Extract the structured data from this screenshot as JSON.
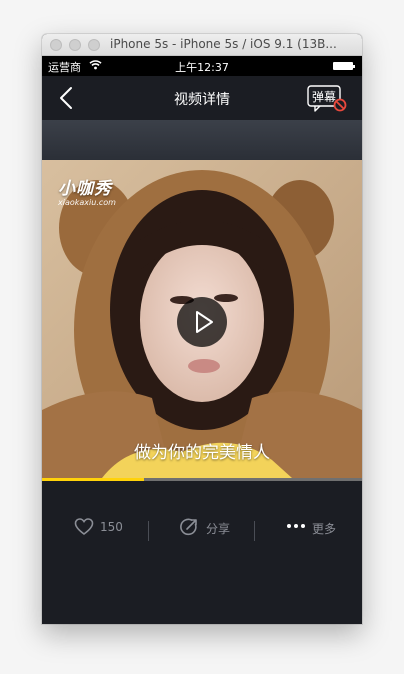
{
  "window": {
    "title": "iPhone 5s - iPhone 5s / iOS 9.1 (13B..."
  },
  "status_bar": {
    "carrier": "运营商",
    "time": "上午12:37"
  },
  "nav": {
    "title": "视频详情",
    "danmu_label": "弹幕"
  },
  "video": {
    "watermark_main": "小咖秀",
    "watermark_sub": "xiaokaxiu.com",
    "subtitle": "做为你的完美情人",
    "progress": 0.32
  },
  "actions": {
    "like_count": "150",
    "share_label": "分享",
    "more_label": "更多"
  },
  "colors": {
    "accent": "#ffd20a",
    "background": "#1b1d23",
    "muted_text": "#8b8e96",
    "danmu_off": "#e8483c"
  },
  "icons": [
    "back-arrow-icon",
    "danmu-icon",
    "play-icon",
    "heart-icon",
    "share-icon",
    "more-dots-icon",
    "wifi-icon",
    "battery-icon"
  ]
}
